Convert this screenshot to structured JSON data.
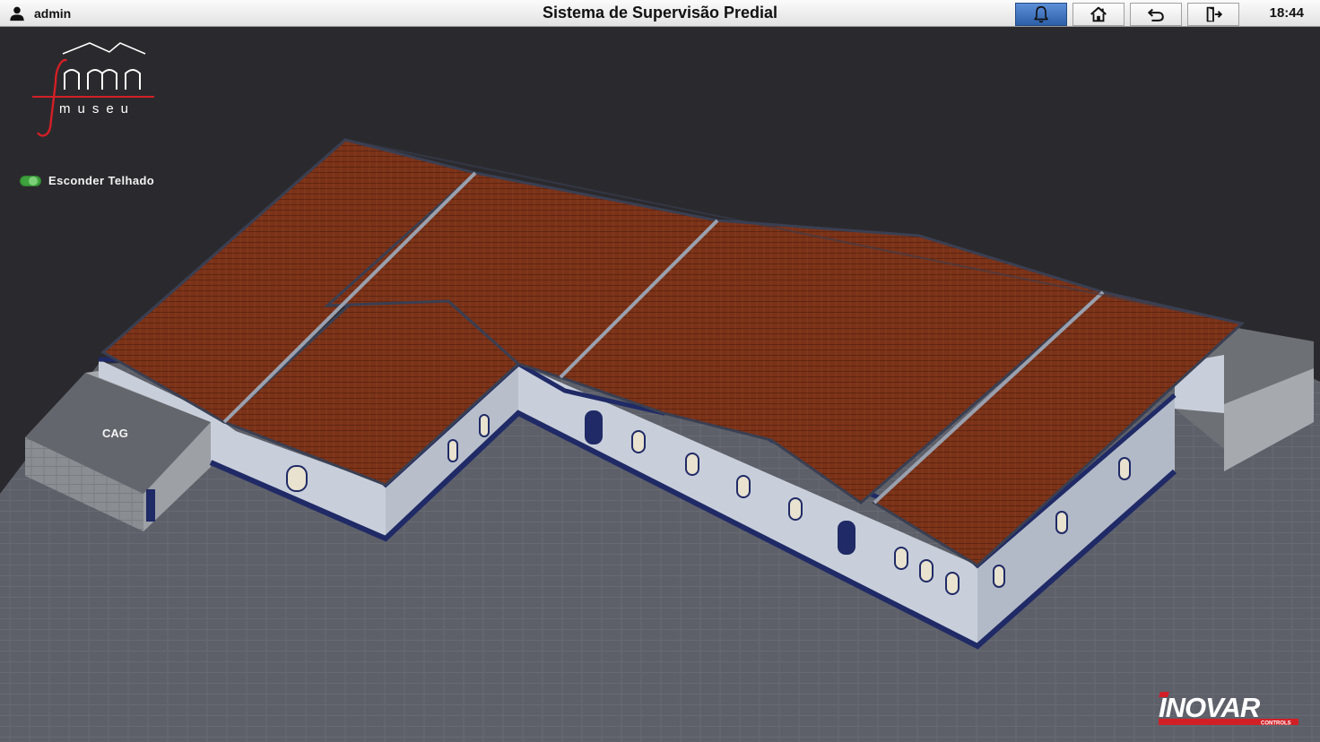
{
  "header": {
    "user": "admin",
    "title": "Sistema de Supervisão Predial",
    "time": "18:44",
    "buttons": [
      {
        "name": "alarms",
        "icon": "bell-icon",
        "active": true
      },
      {
        "name": "home",
        "icon": "home-icon",
        "active": false
      },
      {
        "name": "back",
        "icon": "back-arrow-icon",
        "active": false
      },
      {
        "name": "logout",
        "icon": "exit-door-icon",
        "active": false
      }
    ]
  },
  "logo": {
    "mark": "fnmn",
    "text": "museu"
  },
  "controls": {
    "hide_roof_label": "Esconder Telhado",
    "hide_roof_on": true
  },
  "map": {
    "zone_label": "CAG"
  },
  "brand": {
    "name": "INOVAR",
    "sub": "CONTROLS"
  },
  "colors": {
    "accent_blue": "#2d5fa8",
    "roof": "#7a3218",
    "wall": "#c9cfda",
    "trim": "#1f2a66",
    "toggle_on": "#3ea33c",
    "brand_red": "#d21f26"
  }
}
